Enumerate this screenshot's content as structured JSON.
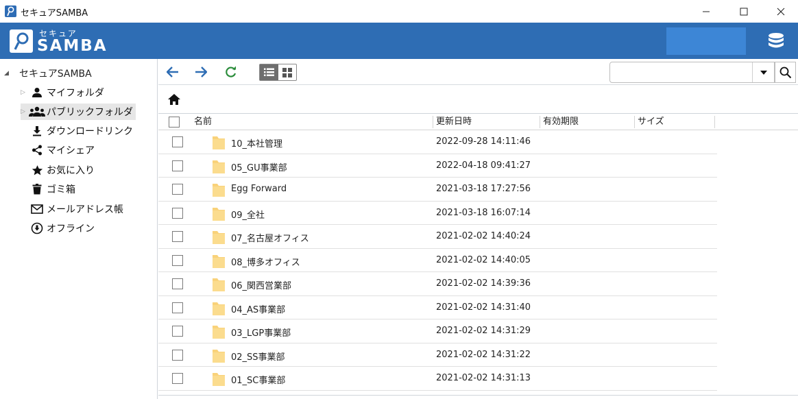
{
  "window": {
    "title": "セキュアSAMBA",
    "controls": {
      "minimize": "—",
      "maximize": "☐",
      "close": "✕"
    }
  },
  "header": {
    "logo_top": "セキュア",
    "logo_main": "SAMBA",
    "brand_color": "#2e6db4"
  },
  "sidebar": {
    "root": "セキュアSAMBA",
    "items": [
      {
        "label": "マイフォルダ",
        "icon": "user-icon",
        "expandable": true
      },
      {
        "label": "パブリックフォルダ",
        "icon": "group-icon",
        "expandable": true,
        "selected": true
      },
      {
        "label": "ダウンロードリンク",
        "icon": "download-icon"
      },
      {
        "label": "マイシェア",
        "icon": "share-icon"
      },
      {
        "label": "お気に入り",
        "icon": "star-icon"
      },
      {
        "label": "ゴミ箱",
        "icon": "trash-icon"
      },
      {
        "label": "メールアドレス帳",
        "icon": "mail-icon"
      },
      {
        "label": "オフライン",
        "icon": "offline-icon"
      }
    ]
  },
  "toolbar": {
    "search_placeholder": ""
  },
  "table": {
    "columns": [
      "名前",
      "更新日時",
      "有効期限",
      "サイズ"
    ],
    "rows": [
      {
        "name": "10_本社管理",
        "date": "2022-09-28 14:11:46"
      },
      {
        "name": "05_GU事業部",
        "date": "2022-04-18 09:41:27"
      },
      {
        "name": "Egg Forward",
        "date": "2021-03-18 17:27:56"
      },
      {
        "name": "09_全社",
        "date": "2021-03-18 16:07:14"
      },
      {
        "name": "07_名古屋オフィス",
        "date": "2021-02-02 14:40:24"
      },
      {
        "name": "08_博多オフィス",
        "date": "2021-02-02 14:40:05"
      },
      {
        "name": "06_関西営業部",
        "date": "2021-02-02 14:39:36"
      },
      {
        "name": "04_AS事業部",
        "date": "2021-02-02 14:31:40"
      },
      {
        "name": "03_LGP事業部",
        "date": "2021-02-02 14:31:29"
      },
      {
        "name": "02_SS事業部",
        "date": "2021-02-02 14:31:22"
      },
      {
        "name": "01_SC事業部",
        "date": "2021-02-02 14:31:13"
      }
    ]
  }
}
